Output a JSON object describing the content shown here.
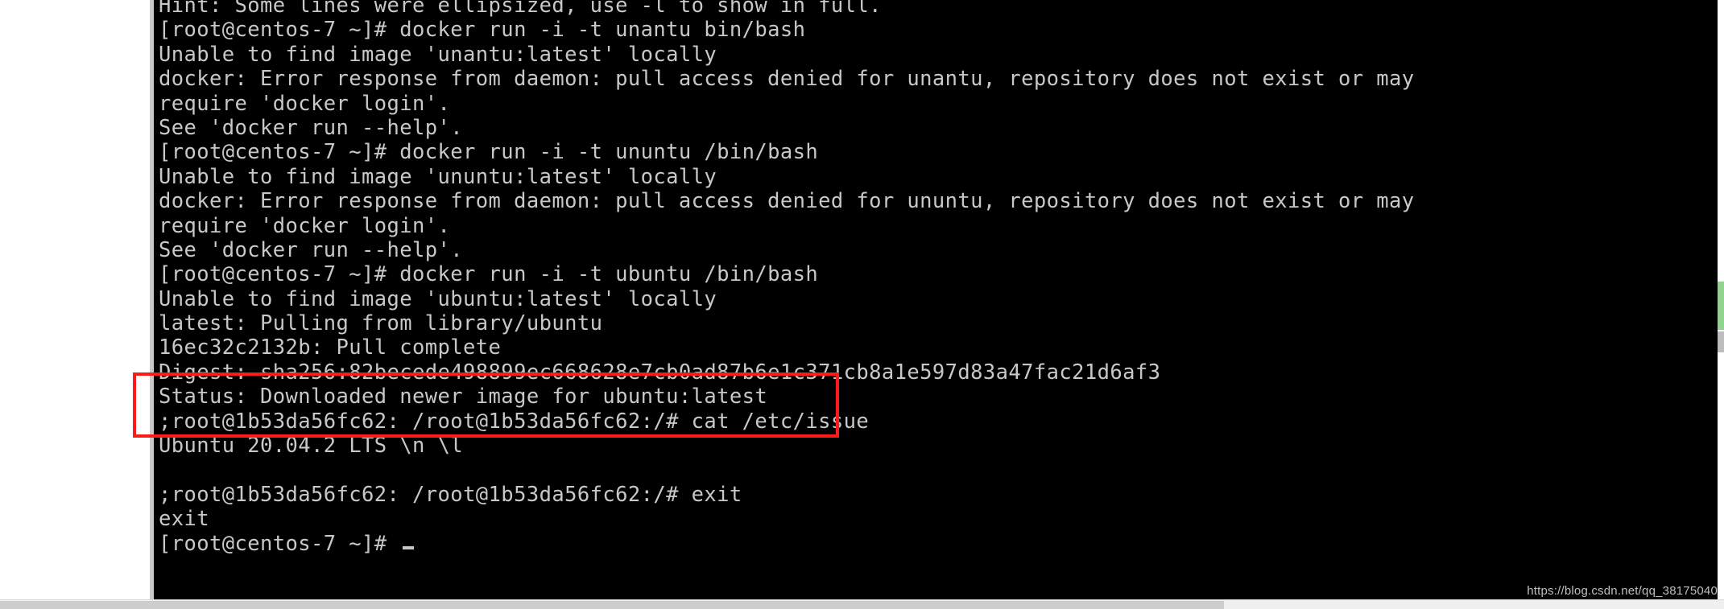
{
  "window": {
    "type": "terminal",
    "background_color": "#000000",
    "foreground_color": "#c8c8c8",
    "page_background_color": "#ffffff"
  },
  "terminal": {
    "hostname_prompt": "[root@centos-7 ~]#",
    "container_prompt": ";root@1b53da56fc62: /root@1b53da56fc62:/#",
    "lines": [
      "Hint: Some lines were ellipsized, use -l to show in full.",
      "[root@centos-7 ~]# docker run -i -t unantu bin/bash",
      "Unable to find image 'unantu:latest' locally",
      "docker: Error response from daemon: pull access denied for unantu, repository does not exist or may",
      "require 'docker login'.",
      "See 'docker run --help'.",
      "[root@centos-7 ~]# docker run -i -t ununtu /bin/bash",
      "Unable to find image 'ununtu:latest' locally",
      "docker: Error response from daemon: pull access denied for ununtu, repository does not exist or may",
      "require 'docker login'.",
      "See 'docker run --help'.",
      "[root@centos-7 ~]# docker run -i -t ubuntu /bin/bash",
      "Unable to find image 'ubuntu:latest' locally",
      "latest: Pulling from library/ubuntu",
      "16ec32c2132b: Pull complete",
      "Digest: sha256:82becede498899ec668628e7cb0ad87b6e1c371cb8a1e597d83a47fac21d6af3",
      "Status: Downloaded newer image for ubuntu:latest",
      ";root@1b53da56fc62: /root@1b53da56fc62:/# cat /etc/issue",
      "Ubuntu 20.04.2 LTS \\n \\l",
      "",
      ";root@1b53da56fc62: /root@1b53da56fc62:/# exit",
      "exit",
      "[root@centos-7 ~]# "
    ]
  },
  "annotation": {
    "highlight_box": {
      "color": "#ff1a1a",
      "covers_lines": [
        ";root@1b53da56fc62: /root@1b53da56fc62:/# exit",
        "exit",
        "[root@centos-7 ~]#"
      ]
    }
  },
  "scrollbars": {
    "vertical_thumb_color": "#8fd48f",
    "horizontal_thumb_color": "#cdcdcd"
  },
  "watermark": {
    "text": "https://blog.csdn.net/qq_38175040",
    "color": "#bfbfbf"
  }
}
